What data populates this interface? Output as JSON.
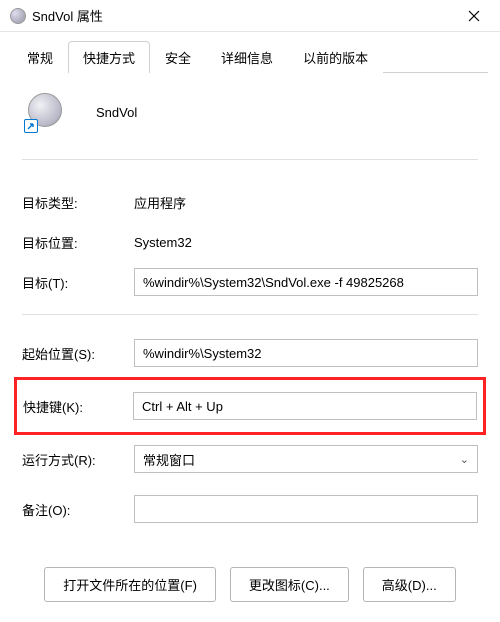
{
  "window": {
    "title": "SndVol 属性"
  },
  "tabs": {
    "t0": "常规",
    "t1": "快捷方式",
    "t2": "安全",
    "t3": "详细信息",
    "t4": "以前的版本"
  },
  "header": {
    "name": "SndVol"
  },
  "rows": {
    "target_type": {
      "label": "目标类型:",
      "value": "应用程序"
    },
    "target_loc": {
      "label": "目标位置:",
      "value": "System32"
    },
    "target": {
      "label": "目标(T):",
      "value": "%windir%\\System32\\SndVol.exe -f 49825268"
    },
    "start_in": {
      "label": "起始位置(S):",
      "value": "%windir%\\System32"
    },
    "shortcut": {
      "label": "快捷键(K):",
      "value": "Ctrl + Alt + Up"
    },
    "run": {
      "label": "运行方式(R):",
      "value": "常规窗口"
    },
    "comment": {
      "label": "备注(O):",
      "value": ""
    }
  },
  "buttons": {
    "open_loc": "打开文件所在的位置(F)",
    "change_icon": "更改图标(C)...",
    "advanced": "高级(D)..."
  }
}
